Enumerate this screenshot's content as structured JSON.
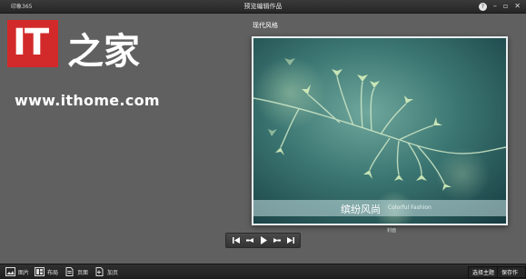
{
  "titlebar": {
    "app_name": "印象365",
    "window_title": "预览编辑作品",
    "controls": [
      "help-icon",
      "minimize-icon",
      "maximize-icon",
      "close-icon"
    ]
  },
  "watermark": {
    "logo_it": "IT",
    "logo_zhijia": "之家",
    "url": "www.ithome.com"
  },
  "album": {
    "style_label": "现代风格",
    "caption": "缤纷风尚",
    "caption_sub": "Colorful Fashion",
    "page_label": "封面"
  },
  "navigation": {
    "buttons": [
      "first-page-icon",
      "prev-page-icon",
      "play-icon",
      "next-page-icon",
      "last-page-icon"
    ]
  },
  "bottombar": {
    "tools": [
      {
        "label": "图片",
        "icon": "image-icon"
      },
      {
        "label": "布局",
        "icon": "layout-icon"
      },
      {
        "label": "页面",
        "icon": "page-icon"
      },
      {
        "label": "加页",
        "icon": "add-page-icon"
      }
    ],
    "select_theme": "选择主题",
    "save_work": "保存作品"
  }
}
